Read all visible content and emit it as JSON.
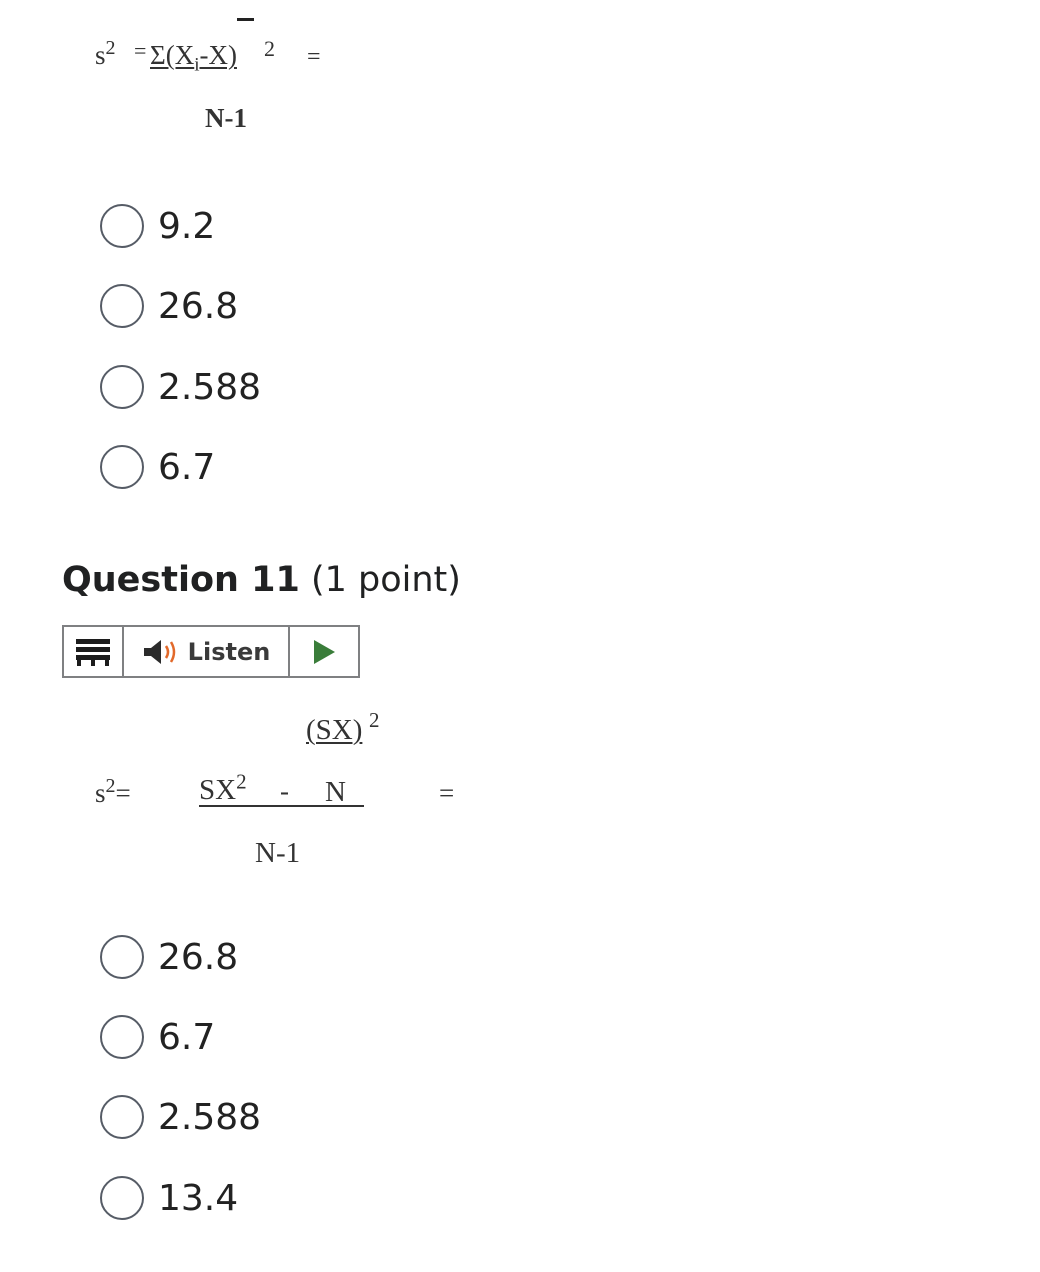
{
  "q10": {
    "formula": {
      "lhs": "s",
      "lhs_exp": "2",
      "eq1": "=",
      "num_a": "Σ(X",
      "num_sub": "i",
      "num_b": "-X)",
      "num_exp": "2",
      "eq2": "=",
      "denominator": "N-1"
    },
    "options": [
      "9.2",
      "26.8",
      "2.588",
      "6.7"
    ]
  },
  "q11": {
    "heading_number": "Question 11",
    "heading_points": "(1 point)",
    "listen_label": "Listen",
    "formula": {
      "lhs": "s",
      "lhs_exp": "2",
      "lhs_eq": "=",
      "inner_num": "(SX)",
      "inner_num_exp": "2",
      "sx": "SX",
      "sx_exp": "2",
      "minus": "-",
      "n": "N",
      "eq": "=",
      "denominator": "N-1"
    },
    "options": [
      "26.8",
      "6.7",
      "2.588",
      "13.4"
    ]
  },
  "colors": {
    "play_green": "#3a7d3a",
    "speaker_dark": "#2b2b2b",
    "speaker_wave": "#e2692a",
    "radio_border": "#565c66"
  }
}
